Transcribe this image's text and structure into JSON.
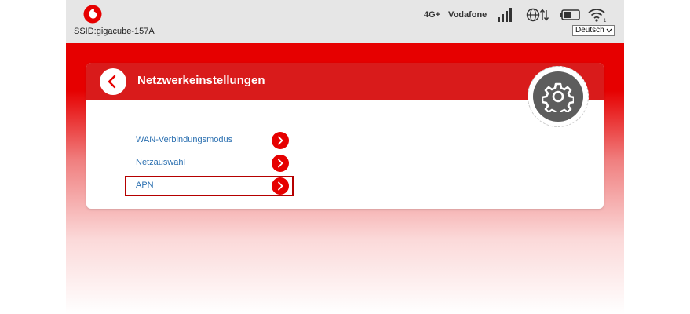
{
  "header": {
    "ssid": "SSID:gigacube-157A",
    "network_type": "4G+",
    "carrier": "Vodafone",
    "language": "Deutsch",
    "icons": [
      "vodafone-logo",
      "signal-bars-icon",
      "globe-transfer-icon",
      "battery-icon",
      "wifi-icon"
    ]
  },
  "card": {
    "title": "Netzwerkeinstellungen",
    "items": [
      {
        "label": "WAN-Verbindungsmodus"
      },
      {
        "label": "Netzauswahl"
      },
      {
        "label": "APN",
        "selected": true
      }
    ]
  },
  "colors": {
    "brand_red": "#e60000",
    "header_red": "#d91b1b",
    "link_blue": "#2a6fb0",
    "gear_gray": "#5d5d5d"
  }
}
